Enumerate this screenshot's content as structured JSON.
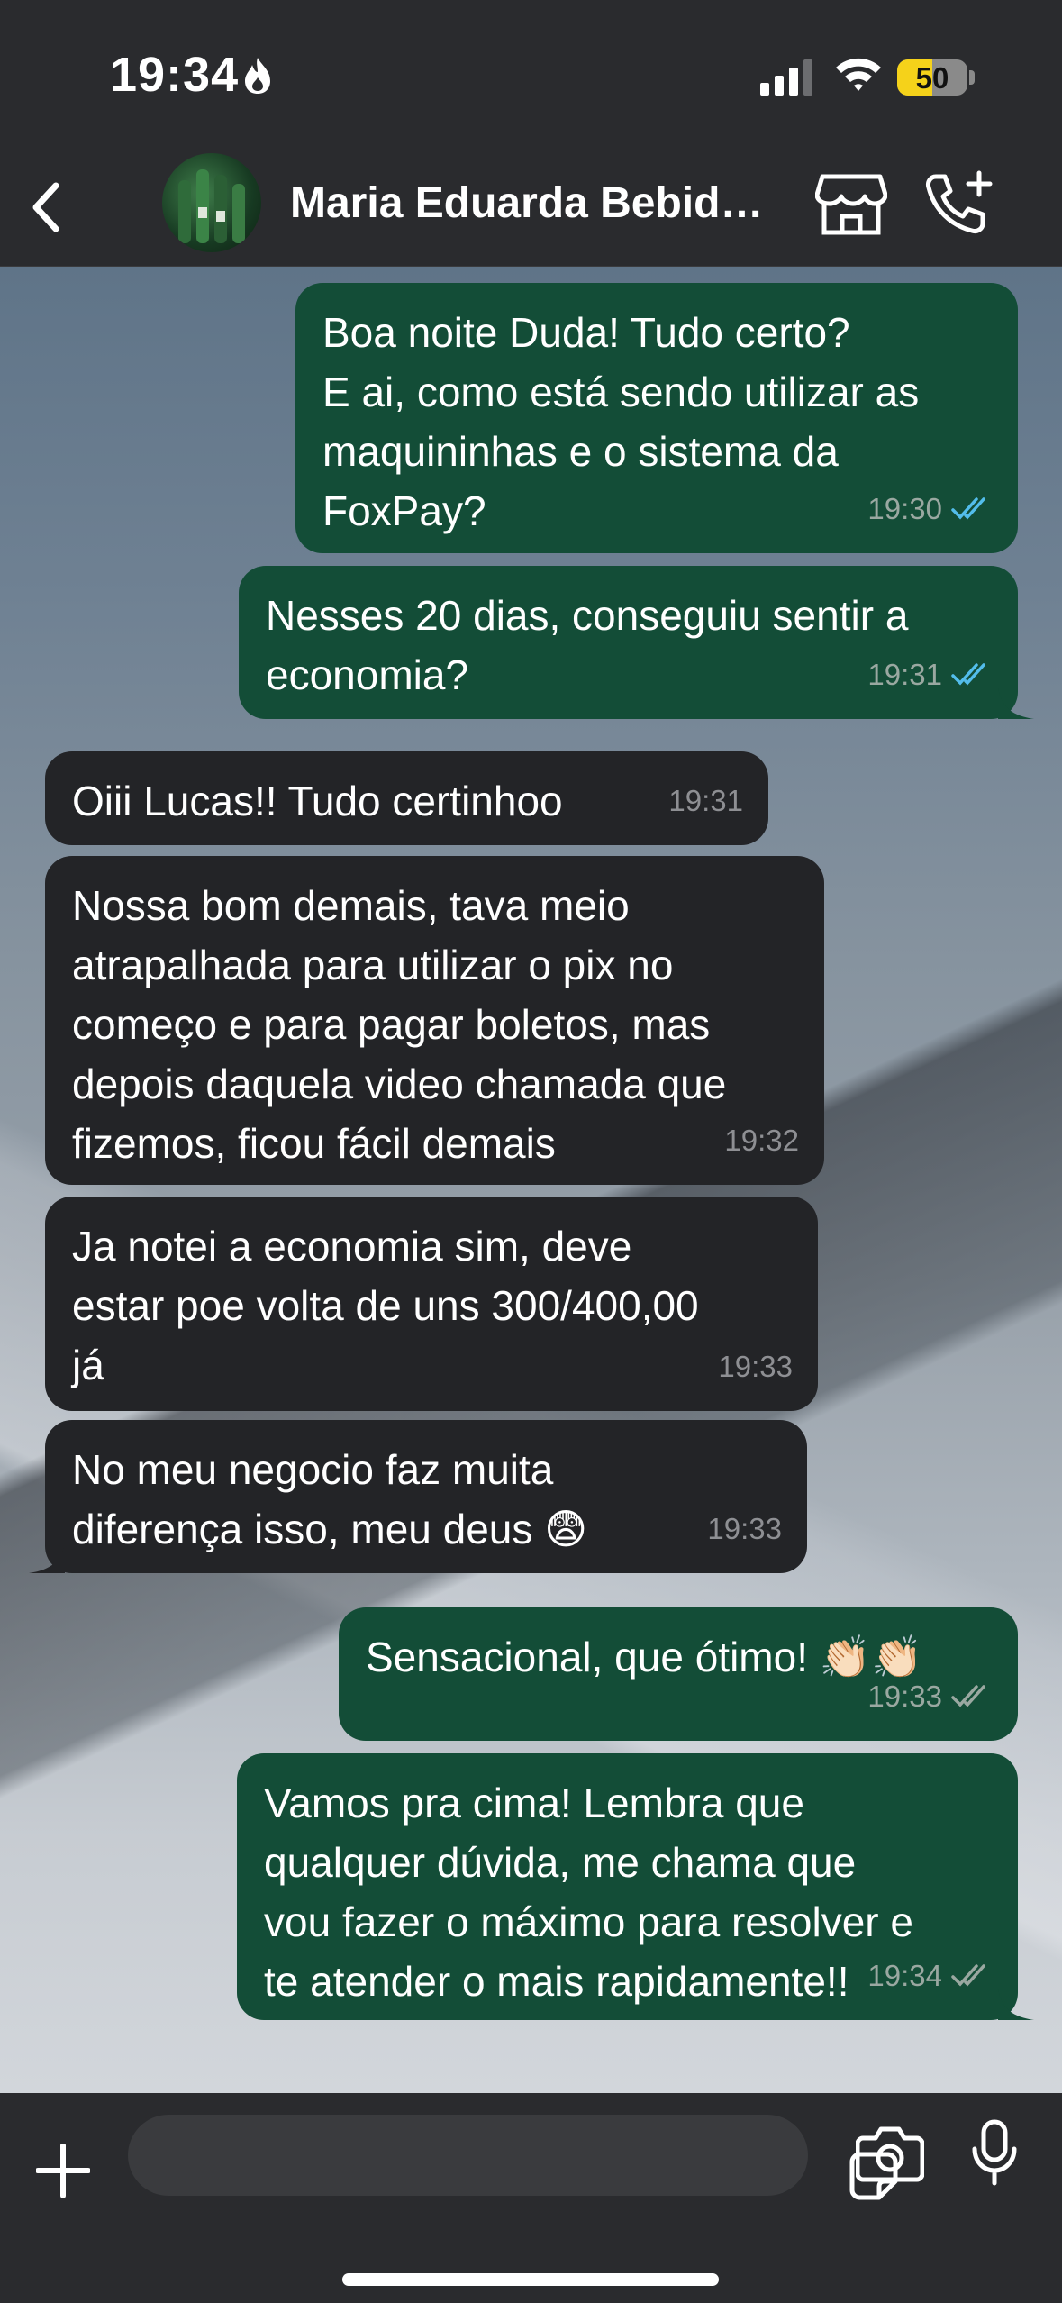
{
  "status_bar": {
    "time": "19:34",
    "battery": "50",
    "battery_level": 0.5
  },
  "header": {
    "contact_name": "Maria Eduarda Bebida…",
    "back_icon": "chevron-left-icon",
    "store_icon": "storefront-icon",
    "call_icon": "phone-plus-icon"
  },
  "messages": [
    {
      "direction": "out",
      "text_lines": [
        "Boa noite Duda! Tudo certo?",
        "E ai, como está sendo utilizar as",
        "maquininhas e o sistema da",
        "FoxPay?"
      ],
      "time": "19:30",
      "status": "read"
    },
    {
      "direction": "out",
      "text_lines": [
        "Nesses 20 dias, conseguiu sentir a",
        "economia?"
      ],
      "time": "19:31",
      "status": "read"
    },
    {
      "direction": "in",
      "text_lines": [
        "Oiii Lucas!! Tudo certinhoo"
      ],
      "time": "19:31"
    },
    {
      "direction": "in",
      "text_lines": [
        "Nossa bom demais, tava meio",
        "atrapalhada para utilizar o pix no",
        "começo e para pagar boletos, mas",
        "depois daquela video chamada que",
        "fizemos, ficou fácil demais"
      ],
      "time": "19:32"
    },
    {
      "direction": "in",
      "text_lines": [
        "Ja notei a economia sim, deve",
        "estar poe volta de uns 300/400,00",
        "já"
      ],
      "time": "19:33"
    },
    {
      "direction": "in",
      "text_lines": [
        "No meu negocio faz muita",
        "diferença isso, meu deus 😨"
      ],
      "time": "19:33"
    },
    {
      "direction": "out",
      "text_lines": [
        "Sensacional, que ótimo! 👏🏻👏🏻"
      ],
      "time": "19:33",
      "status": "delivered"
    },
    {
      "direction": "out",
      "text_lines": [
        "Vamos pra cima! Lembra que",
        "qualquer dúvida, me chama que",
        "vou fazer o máximo para resolver e",
        "te atender o mais rapidamente!!"
      ],
      "time": "19:34",
      "status": "delivered"
    }
  ],
  "input": {
    "placeholder": "",
    "icons": [
      "plus-icon",
      "sticker-icon",
      "camera-icon",
      "microphone-icon"
    ]
  },
  "colors": {
    "outgoing_bubble": "#134d37",
    "incoming_bubble": "#232427",
    "read_tick": "#53bdeb",
    "delivered_tick": "#9aa8a1"
  }
}
